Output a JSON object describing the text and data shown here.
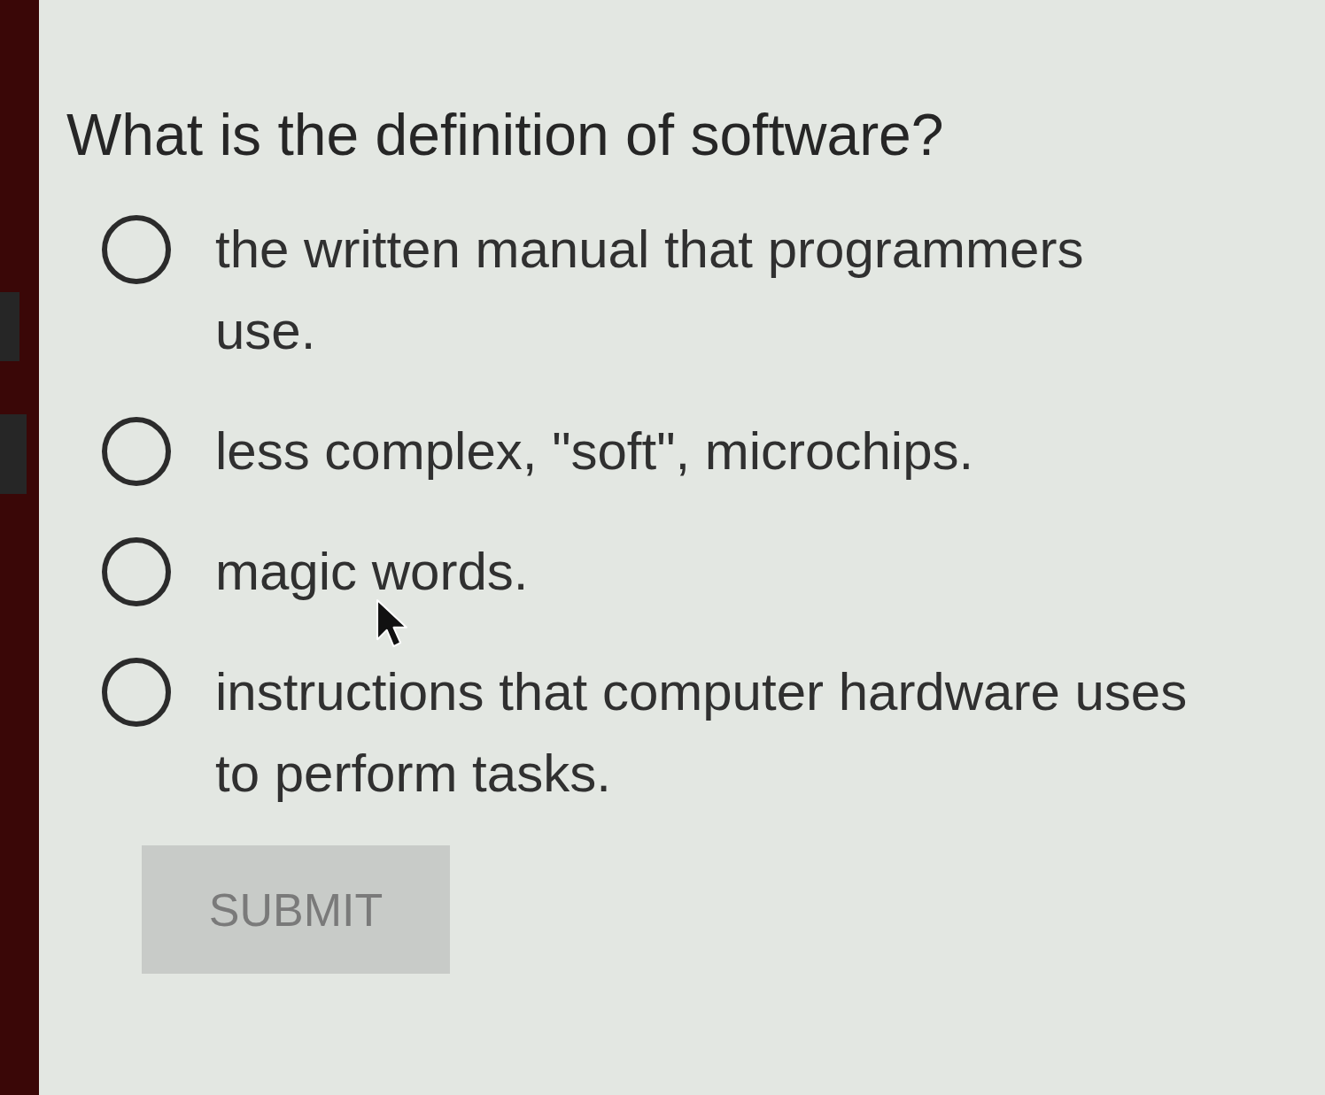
{
  "question": {
    "text": "What is the definition of software?"
  },
  "options": [
    {
      "label": "the written manual that programmers use.",
      "selected": false
    },
    {
      "label": "less complex, \"soft\", microchips.",
      "selected": false
    },
    {
      "label": "magic words.",
      "selected": false
    },
    {
      "label": "instructions that computer hardware uses to perform tasks.",
      "selected": false
    }
  ],
  "submit": {
    "label": "SUBMIT",
    "disabled": true
  }
}
